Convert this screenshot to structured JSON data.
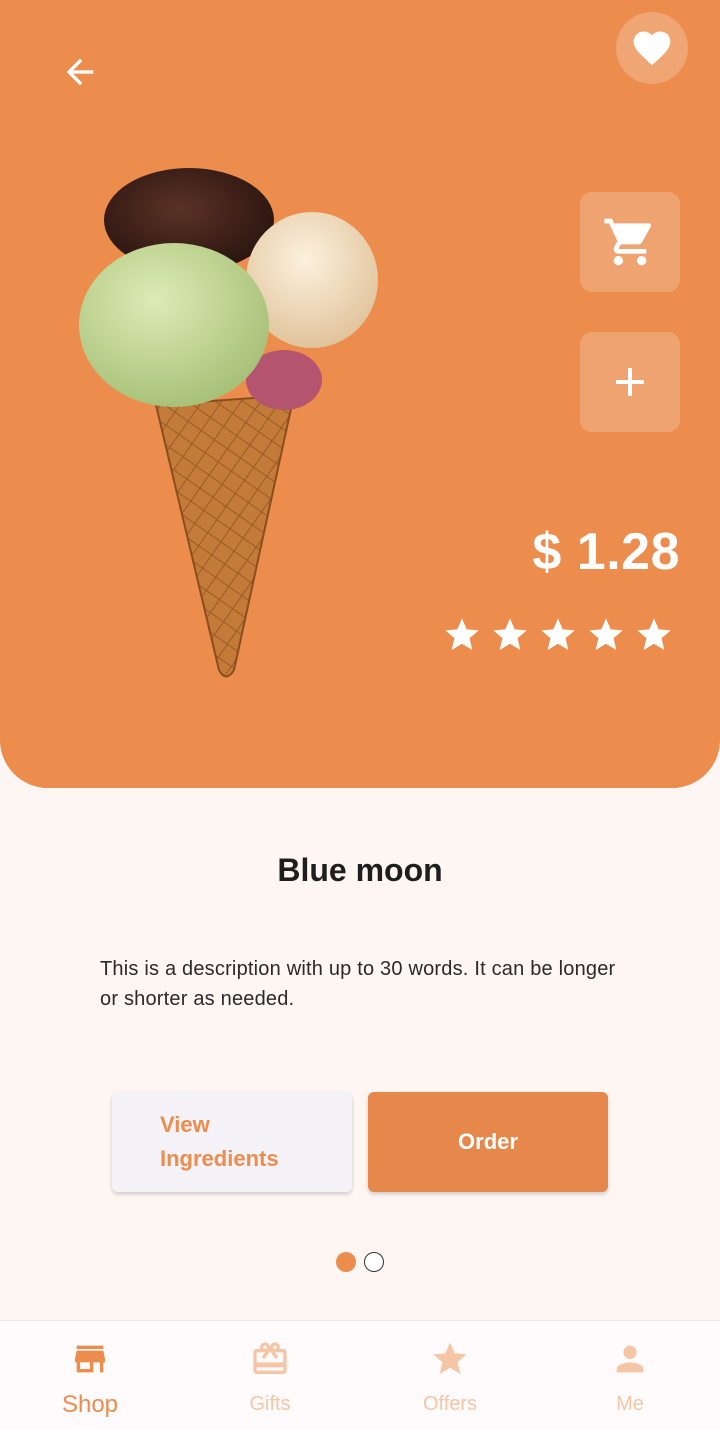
{
  "product": {
    "name": "Blue moon",
    "price": "$ 1.28",
    "rating": 5,
    "rating_max": 5,
    "description": "This is a description with up to 30 words. It can be longer or shorter as needed."
  },
  "actions": {
    "view_ingredients_label": "View Ingredients",
    "order_label": "Order"
  },
  "pager": {
    "count": 2,
    "active_index": 0
  },
  "icons": {
    "back": "arrow-left-icon",
    "favorite": "heart-icon",
    "cart": "shopping-cart-icon",
    "add": "plus-icon",
    "star": "star-icon"
  },
  "bottom_nav": {
    "items": [
      {
        "label": "Shop",
        "icon": "store-icon",
        "active": true
      },
      {
        "label": "Gifts",
        "icon": "gift-icon",
        "active": false
      },
      {
        "label": "Offers",
        "icon": "star-icon",
        "active": false
      },
      {
        "label": "Me",
        "icon": "person-icon",
        "active": false
      }
    ]
  },
  "colors": {
    "accent": "#EC8C4D",
    "accent_light": "#F4C6A6",
    "background": "#FDF6F2"
  }
}
